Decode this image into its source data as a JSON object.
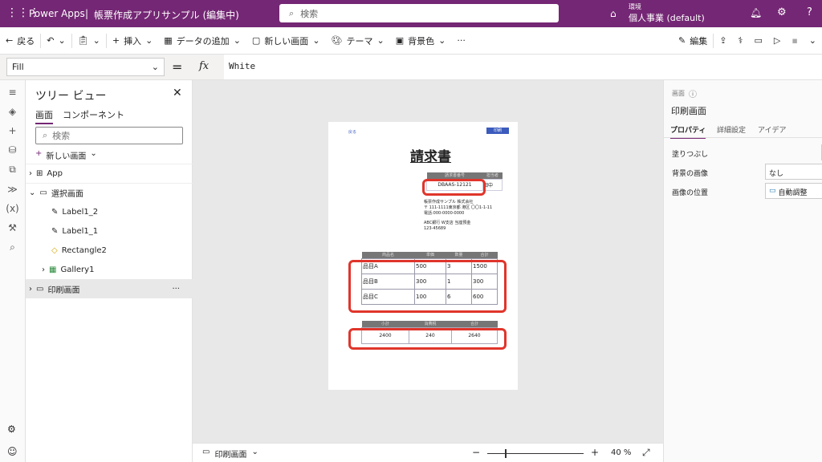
{
  "topbar": {
    "app": "Power Apps",
    "separator": "|",
    "title": "帳票作成アプリサンプル (編集中)",
    "search_placeholder": "検索",
    "env_label": "環境",
    "env_name": "個人事業 (default)"
  },
  "cmd": {
    "back": "戻る",
    "insert": "挿入",
    "add_data": "データの追加",
    "new_screen": "新しい画面",
    "theme": "テーマ",
    "bg_color": "背景色",
    "more": "···",
    "edit": "編集"
  },
  "formula": {
    "property": "Fill",
    "eq": "=",
    "fx": "fx",
    "value": "White"
  },
  "tree": {
    "title": "ツリー ビュー",
    "tabs": [
      "画面",
      "コンポーネント"
    ],
    "search_placeholder": "検索",
    "new_screen": "新しい画面",
    "items": [
      {
        "label": "App"
      },
      {
        "label": "選択画面"
      },
      {
        "label": "Label1_2"
      },
      {
        "label": "Label1_1"
      },
      {
        "label": "Rectangle2"
      },
      {
        "label": "Gallery1"
      },
      {
        "label": "印刷画面",
        "more": "···"
      }
    ]
  },
  "invoice": {
    "back": "戻る",
    "print": "印刷",
    "title": "請求書",
    "no_header": "請求書番号",
    "staff_header": "担当者",
    "no": "DBAAS-12121",
    "staff": "田中",
    "address": [
      "帳票作成サンプル 株式会社",
      "〒 111-1111東京都 港区 〇〇1-1-11",
      "電話:000-0000-0000"
    ],
    "bank": [
      "ABC銀行 W支店 当座預金",
      "123-45689"
    ],
    "columns": [
      "商品名",
      "単価",
      "数量",
      "合計"
    ],
    "rows": [
      [
        "品目A",
        "500",
        "3",
        "1500"
      ],
      [
        "品目B",
        "300",
        "1",
        "300"
      ],
      [
        "品目C",
        "100",
        "6",
        "600"
      ]
    ],
    "sum_columns": [
      "小計",
      "消費税",
      "合計"
    ],
    "sums": [
      "2400",
      "240",
      "2640"
    ]
  },
  "status": {
    "screen": "印刷画面",
    "minus": "−",
    "plus": "+",
    "zoom": "40 %",
    "zoom_level": 40
  },
  "props": {
    "kind": "画面",
    "name": "印刷画面",
    "tabs": [
      "プロパティ",
      "詳細設定",
      "アイデア"
    ],
    "fill_label": "塗りつぶし",
    "bgimg_label": "背景の画像",
    "bgimg_value": "なし",
    "pos_label": "画像の位置",
    "pos_value": "自動調整"
  },
  "colors": {
    "brand": "#742774",
    "highlight": "#e0352b",
    "button": "#3b5bbd"
  }
}
